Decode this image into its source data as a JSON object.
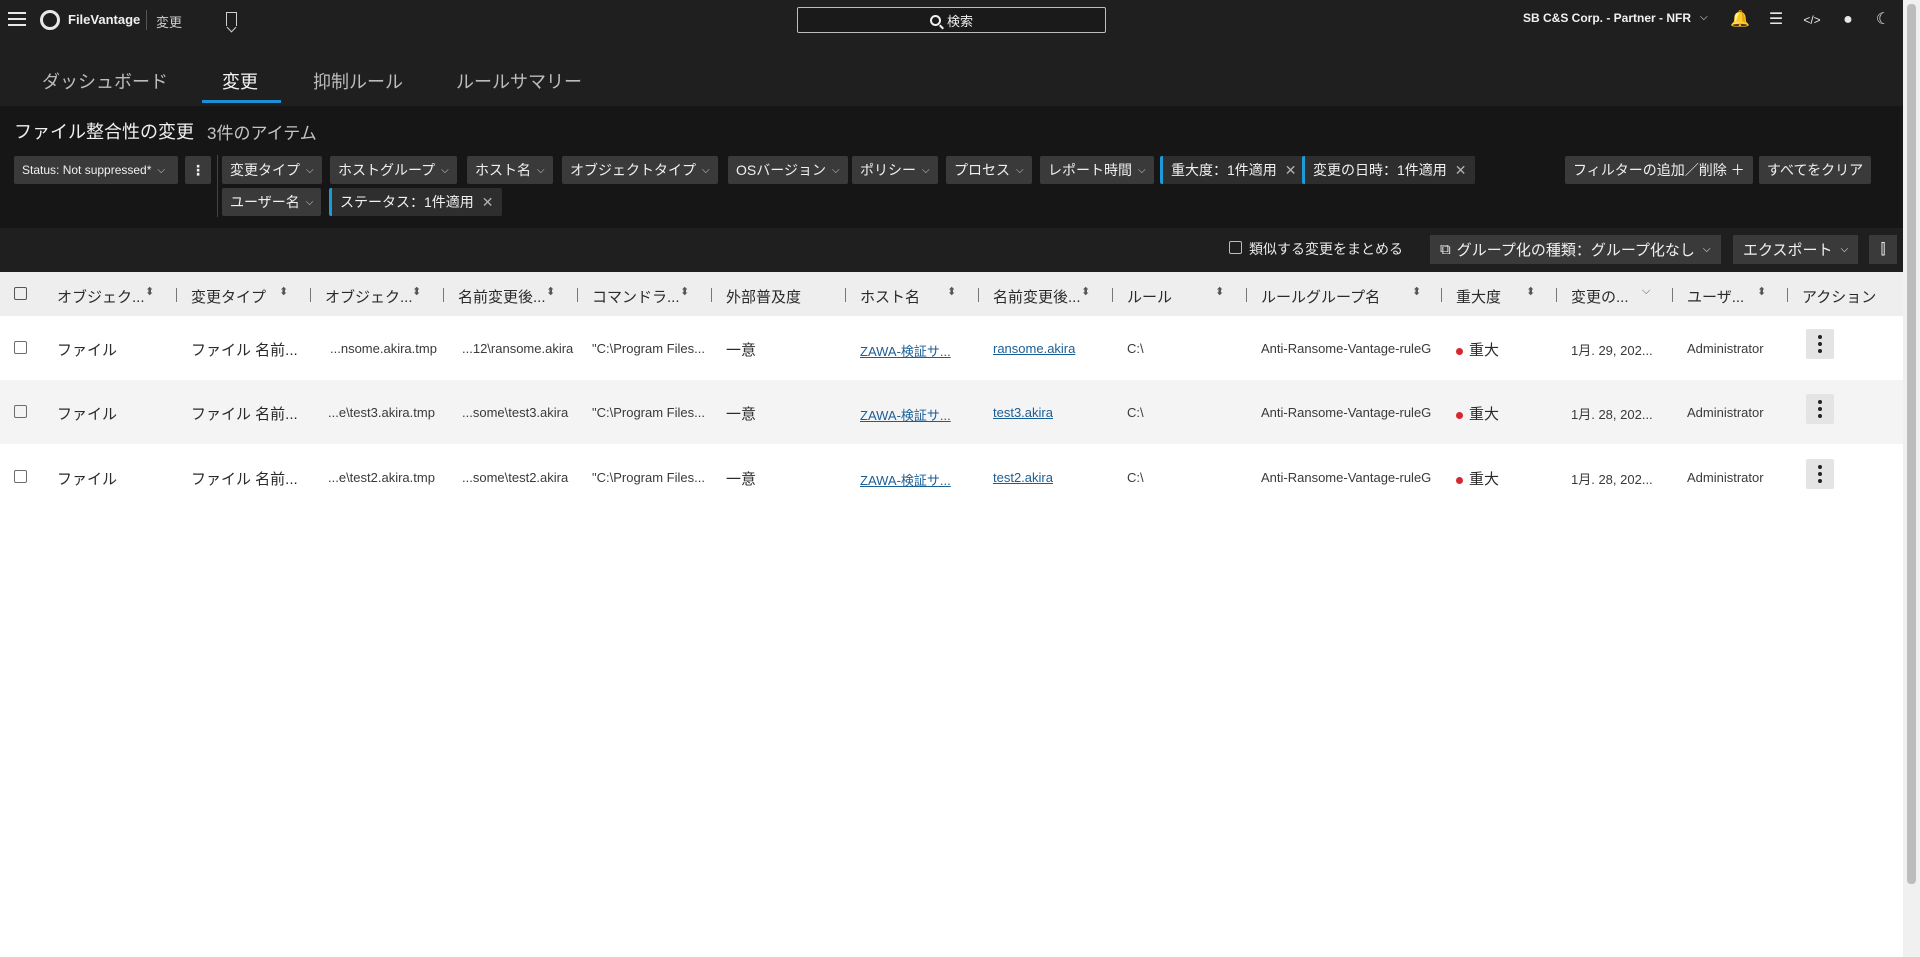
{
  "topbar": {
    "app_name": "FileVantage",
    "breadcrumb": "変更",
    "search_label": "検索",
    "org_name": "SB C&S Corp. - Partner - NFR"
  },
  "icons": [
    "menu-icon",
    "logo-icon",
    "bookmark-icon",
    "search-icon",
    "chevron-down-icon",
    "bell-icon",
    "news-icon",
    "code-icon",
    "user-icon",
    "moon-icon",
    "close-icon",
    "columns-icon",
    "group-icon",
    "sort-icon",
    "kebab-icon"
  ],
  "tabs": [
    {
      "label": "ダッシュボード",
      "active": false
    },
    {
      "label": "変更",
      "active": true
    },
    {
      "label": "抑制ルール",
      "active": false
    },
    {
      "label": "ルールサマリー",
      "active": false
    }
  ],
  "page": {
    "title": "ファイル整合性の変更",
    "count": "3件のアイテム"
  },
  "filters": {
    "saved_view": "Status: Not suppressed*",
    "row1": [
      "変更タイプ",
      "ホストグループ",
      "ホスト名",
      "オブジェクトタイプ",
      "OSバージョン",
      "ポリシー",
      "プロセス",
      "レポート時間"
    ],
    "applied1": [
      {
        "label": "重大度：1件適用"
      },
      {
        "label": "変更の日時：1件適用"
      }
    ],
    "row2": [
      "ユーザー名"
    ],
    "applied2": [
      {
        "label": "ステータス：1件適用"
      }
    ],
    "add_remove": "フィルターの追加／削除 ＋",
    "clear_all": "すべてをクリア"
  },
  "toolbar": {
    "group_similar": "類似する変更をまとめる",
    "grouping": "グループ化の種類：グループ化なし",
    "export": "エクスポート"
  },
  "table": {
    "headers": [
      "オブジェク...",
      "変更タイプ",
      "オブジェク...",
      "名前変更後...",
      "コマンドラ...",
      "外部普及度",
      "ホスト名",
      "名前変更後...",
      "ルール",
      "ルールグループ名",
      "重大度",
      "変更の...",
      "ユーザ...",
      "アクション"
    ],
    "rows": [
      {
        "object_type": "ファイル",
        "change_type": "ファイル 名前...",
        "object": "...nsome.akira.tmp",
        "renamed_path": "...12\\ransome.akira",
        "cmdline": "\"C:\\Program Files...",
        "prevalence": "一意",
        "host": "ZAWA-検証サ...",
        "renamed_name": "ransome.akira",
        "rule": "C:\\",
        "rule_group": "Anti-Ransome-Vantage-ruleG",
        "severity": "重大",
        "date": "1月. 29, 202...",
        "user": "Administrator"
      },
      {
        "object_type": "ファイル",
        "change_type": "ファイル 名前...",
        "object": "...e\\test3.akira.tmp",
        "renamed_path": "...some\\test3.akira",
        "cmdline": "\"C:\\Program Files...",
        "prevalence": "一意",
        "host": "ZAWA-検証サ...",
        "renamed_name": "test3.akira",
        "rule": "C:\\",
        "rule_group": "Anti-Ransome-Vantage-ruleG",
        "severity": "重大",
        "date": "1月. 28, 202...",
        "user": "Administrator"
      },
      {
        "object_type": "ファイル",
        "change_type": "ファイル 名前...",
        "object": "...e\\test2.akira.tmp",
        "renamed_path": "...some\\test2.akira",
        "cmdline": "\"C:\\Program Files...",
        "prevalence": "一意",
        "host": "ZAWA-検証サ...",
        "renamed_name": "test2.akira",
        "rule": "C:\\",
        "rule_group": "Anti-Ransome-Vantage-ruleG",
        "severity": "重大",
        "date": "1月. 28, 202...",
        "user": "Administrator"
      }
    ]
  },
  "colors": {
    "header_bg": "#1f1f1f",
    "accent": "#1d8fd4",
    "severity_critical": "#d8262e",
    "link": "#1a5e96"
  }
}
